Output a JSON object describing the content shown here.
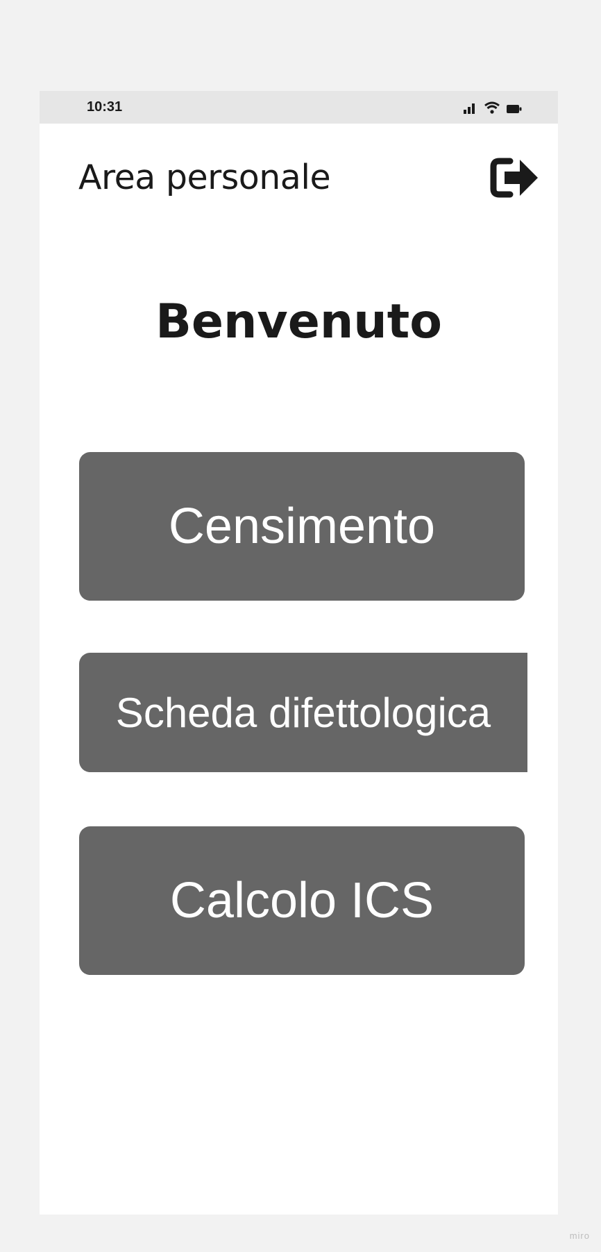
{
  "status_bar": {
    "time": "10:31",
    "icons": [
      "signal-icon",
      "wifi-icon",
      "battery-icon"
    ]
  },
  "header": {
    "title": "Area personale",
    "logout_icon": "logout-icon"
  },
  "welcome": {
    "text": "Benvenuto"
  },
  "menu": {
    "items": [
      {
        "label": "Censimento"
      },
      {
        "label": "Scheda difettologica"
      },
      {
        "label": "Calcolo ICS"
      }
    ]
  },
  "watermark": "miro",
  "colors": {
    "button_bg": "#666666",
    "button_text": "#ffffff",
    "status_bar_bg": "#e6e6e6",
    "page_bg": "#f2f2f2",
    "text": "#1a1a1a"
  }
}
